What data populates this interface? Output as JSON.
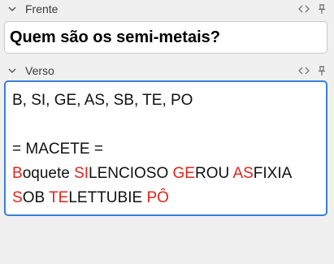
{
  "front_field": {
    "label": "Frente",
    "content": "Quem são os semi-metais?"
  },
  "back_field": {
    "label": "Verso",
    "lines": [
      [
        {
          "text": "B, SI, GE, AS, SB, TE, PO",
          "highlight": false
        }
      ],
      [],
      [
        {
          "text": "= MACETE =",
          "highlight": false
        }
      ],
      [
        {
          "text": "B",
          "highlight": true
        },
        {
          "text": "oquete ",
          "highlight": false
        },
        {
          "text": "SI",
          "highlight": true
        },
        {
          "text": "LENCIOSO ",
          "highlight": false
        },
        {
          "text": "GE",
          "highlight": true
        },
        {
          "text": "ROU ",
          "highlight": false
        },
        {
          "text": "AS",
          "highlight": true
        },
        {
          "text": "FIXIA",
          "highlight": false
        }
      ],
      [
        {
          "text": "S",
          "highlight": true
        },
        {
          "text": "OB ",
          "highlight": false
        },
        {
          "text": "TE",
          "highlight": true
        },
        {
          "text": "LETTUBIE ",
          "highlight": false
        },
        {
          "text": "PÔ",
          "highlight": true
        }
      ]
    ]
  },
  "colors": {
    "highlight": "#e0251b",
    "focus_border": "#3a7fd6",
    "background": "#f0f0f0"
  },
  "icons": [
    "chevron-down-icon",
    "html-editor-icon",
    "pin-icon"
  ]
}
